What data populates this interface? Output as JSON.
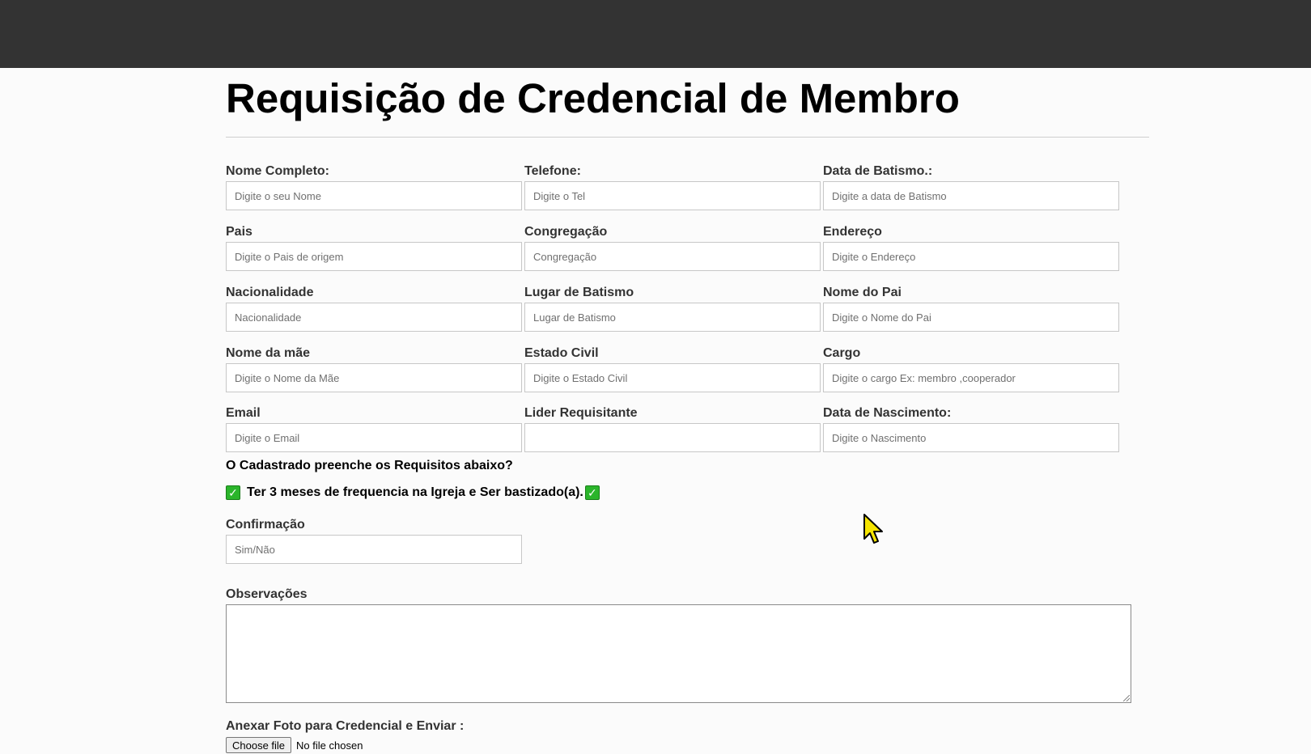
{
  "page": {
    "title": "Requisição de Credencial de Membro"
  },
  "form": {
    "fields": [
      {
        "label": "Nome Completo:",
        "placeholder": "Digite o seu Nome",
        "value": ""
      },
      {
        "label": "Telefone:",
        "placeholder": "Digite o Tel",
        "value": ""
      },
      {
        "label": "Data de Batismo.:",
        "placeholder": "Digite a data de Batismo",
        "value": ""
      },
      {
        "label": "Pais",
        "placeholder": "Digite o Pais de origem",
        "value": ""
      },
      {
        "label": "Congregação",
        "placeholder": "Congregação",
        "value": ""
      },
      {
        "label": "Endereço",
        "placeholder": "Digite o Endereço",
        "value": ""
      },
      {
        "label": "Nacionalidade",
        "placeholder": "Nacionalidade",
        "value": ""
      },
      {
        "label": "Lugar de Batismo",
        "placeholder": "Lugar de Batismo",
        "value": ""
      },
      {
        "label": "Nome do Pai",
        "placeholder": "Digite o Nome do Pai",
        "value": ""
      },
      {
        "label": "Nome da mãe",
        "placeholder": "Digite o Nome da Mãe",
        "value": ""
      },
      {
        "label": "Estado Civil",
        "placeholder": "Digite o Estado Civil",
        "value": ""
      },
      {
        "label": "Cargo",
        "placeholder": "Digite o cargo Ex: membro ,cooperador",
        "value": ""
      },
      {
        "label": "Email",
        "placeholder": "Digite o Email",
        "value": ""
      },
      {
        "label": "Lider Requisitante",
        "placeholder": "",
        "value": ""
      },
      {
        "label": "Data de Nascimento:",
        "placeholder": "Digite o Nascimento",
        "value": ""
      }
    ],
    "requirements": {
      "question": "O Cadastrado preenche os Requisitos abaixo?",
      "item_text": "Ter 3 meses de frequencia na Igreja e Ser bastizado(a).",
      "check_glyph": "✓"
    },
    "confirmation": {
      "label": "Confirmação",
      "placeholder": "Sim/Não",
      "value": ""
    },
    "observations": {
      "label": "Observações",
      "value": ""
    },
    "attachment": {
      "label": "Anexar Foto para Credencial e Enviar :",
      "button_label": "Choose file",
      "status": "No file chosen"
    }
  },
  "colors": {
    "topbar": "#333333",
    "check_green": "#2bb52b",
    "cursor_yellow": "#f5e400"
  },
  "icons": {
    "cursor": "mouse-pointer-icon",
    "check": "checkmark-icon"
  }
}
